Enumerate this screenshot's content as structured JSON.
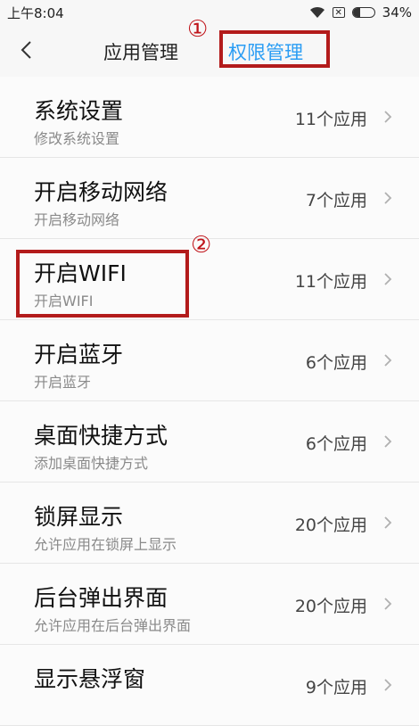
{
  "status_bar": {
    "time": "上午8:04",
    "sim_label": "✕",
    "battery_text": "34%",
    "battery_level": 0.34
  },
  "nav": {
    "tab_app": "应用管理",
    "tab_permissions": "权限管理"
  },
  "annotations": {
    "marker_1": "①",
    "marker_2": "②"
  },
  "permissions": [
    {
      "title": "系统设置",
      "subtitle": "修改系统设置",
      "count": "11个应用"
    },
    {
      "title": "开启移动网络",
      "subtitle": "开启移动网络",
      "count": "7个应用"
    },
    {
      "title": "开启WIFI",
      "subtitle": "开启WIFI",
      "count": "11个应用"
    },
    {
      "title": "开启蓝牙",
      "subtitle": "开启蓝牙",
      "count": "6个应用"
    },
    {
      "title": "桌面快捷方式",
      "subtitle": "添加桌面快捷方式",
      "count": "6个应用"
    },
    {
      "title": "锁屏显示",
      "subtitle": "允许应用在锁屏上显示",
      "count": "20个应用"
    },
    {
      "title": "后台弹出界面",
      "subtitle": "允许应用在后台弹出界面",
      "count": "20个应用"
    },
    {
      "title": "显示悬浮窗",
      "subtitle": "",
      "count": "9个应用"
    }
  ],
  "colors": {
    "accent": "#2a9df4",
    "annotation_red": "#b31b1b"
  }
}
